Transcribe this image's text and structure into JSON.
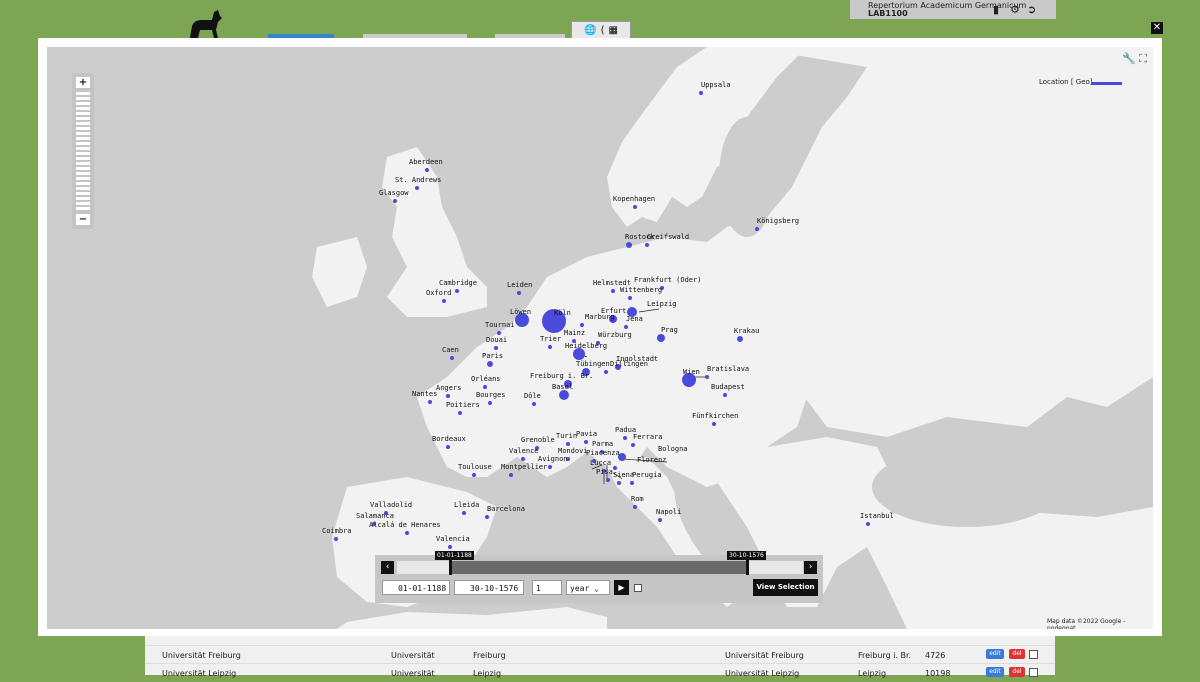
{
  "app": {
    "title": "Repertorium Academicum Germanicum",
    "user": "LAB1100"
  },
  "legend": {
    "label": "Location [ Geo]",
    "color": "#4a4adb"
  },
  "attribution": {
    "text": "Map data ©2022 Google - ",
    "link": "nodegoat"
  },
  "timeline": {
    "start_label": "01-01-1188",
    "end_label": "30-10-1576",
    "start_date": "01-01-1188",
    "end_date": "30-10-1576",
    "step": "1",
    "unit": "year",
    "view_button": "View Selection"
  },
  "table_rows": [
    {
      "name": "Universität Freiburg",
      "type": "Universität",
      "city": "Freiburg",
      "name2": "Universität Freiburg",
      "place": "Freiburg i. Br.",
      "count": "4726",
      "edit": "edit",
      "del": "del"
    },
    {
      "name": "Universität Leipzig",
      "type": "Universität",
      "city": "Leipzig",
      "name2": "Universität Leipzig",
      "place": "Leipzig",
      "count": "10198",
      "edit": "edit",
      "del": "del"
    }
  ],
  "cities": [
    {
      "name": "Uppsala"
    },
    {
      "name": "Aberdeen"
    },
    {
      "name": "St. Andrews"
    },
    {
      "name": "Glasgow"
    },
    {
      "name": "Kopenhagen"
    },
    {
      "name": "Königsberg"
    },
    {
      "name": "Rostock"
    },
    {
      "name": "Greifswald"
    },
    {
      "name": "Cambridge"
    },
    {
      "name": "Oxford"
    },
    {
      "name": "Leiden"
    },
    {
      "name": "Helmstedt"
    },
    {
      "name": "Frankfurt (Oder)"
    },
    {
      "name": "Wittenberg"
    },
    {
      "name": "Erfurt"
    },
    {
      "name": "Leipzig"
    },
    {
      "name": "Löwen"
    },
    {
      "name": "Köln"
    },
    {
      "name": "Marburg"
    },
    {
      "name": "Tournai"
    },
    {
      "name": "Jena"
    },
    {
      "name": "Prag"
    },
    {
      "name": "Krakau"
    },
    {
      "name": "Mainz"
    },
    {
      "name": "Würzburg"
    },
    {
      "name": "Trier"
    },
    {
      "name": "Douai"
    },
    {
      "name": "Caen"
    },
    {
      "name": "Paris"
    },
    {
      "name": "Heidelberg"
    },
    {
      "name": "Ingolstadt"
    },
    {
      "name": "Tübingen"
    },
    {
      "name": "Dillingen"
    },
    {
      "name": "Wien"
    },
    {
      "name": "Bratislava"
    },
    {
      "name": "Orléans"
    },
    {
      "name": "Freiburg i. Br."
    },
    {
      "name": "Budapest"
    },
    {
      "name": "Angers"
    },
    {
      "name": "Nantes"
    },
    {
      "name": "Bourges"
    },
    {
      "name": "Dôle"
    },
    {
      "name": "Basel"
    },
    {
      "name": "Poitiers"
    },
    {
      "name": "Fünfkirchen"
    },
    {
      "name": "Padua"
    },
    {
      "name": "Bordeaux"
    },
    {
      "name": "Grenoble"
    },
    {
      "name": "Turin"
    },
    {
      "name": "Pavia"
    },
    {
      "name": "Ferrara"
    },
    {
      "name": "Parma"
    },
    {
      "name": "Valence"
    },
    {
      "name": "Mondovi"
    },
    {
      "name": "Bologna"
    },
    {
      "name": "Piacenza"
    },
    {
      "name": "Avignon"
    },
    {
      "name": "Florenz"
    },
    {
      "name": "Toulouse"
    },
    {
      "name": "Montpellier"
    },
    {
      "name": "Lucca"
    },
    {
      "name": "Pisa"
    },
    {
      "name": "Siena"
    },
    {
      "name": "Perugia"
    },
    {
      "name": "Rom"
    },
    {
      "name": "Valladolid"
    },
    {
      "name": "Salamanca"
    },
    {
      "name": "Lleida"
    },
    {
      "name": "Napoli"
    },
    {
      "name": "Istanbul"
    },
    {
      "name": "Barcelona"
    },
    {
      "name": "Coimbra"
    },
    {
      "name": "Alcalá de Henares"
    },
    {
      "name": "Valencia"
    }
  ]
}
